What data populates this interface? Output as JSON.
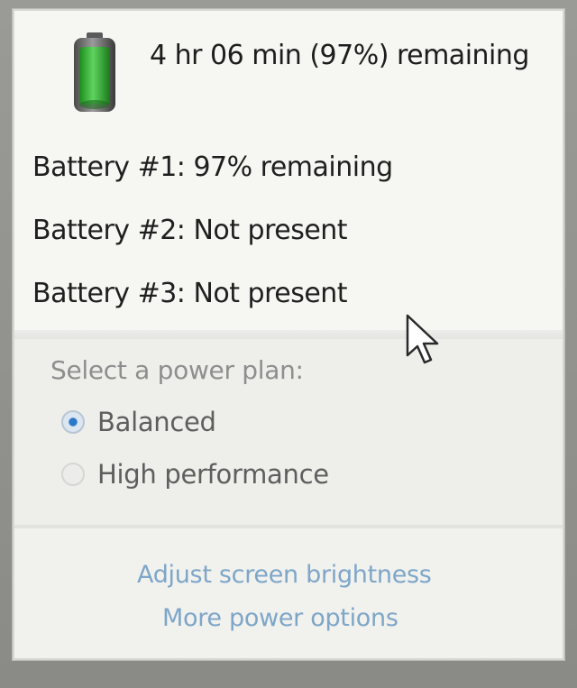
{
  "battery": {
    "summary": "4 hr 06 min (97%) remaining",
    "level_percent": 97,
    "icon": "battery-icon",
    "batteries": [
      {
        "label": "Battery #1: 97% remaining"
      },
      {
        "label": "Battery #2: Not present"
      },
      {
        "label": "Battery #3: Not present"
      }
    ]
  },
  "power_plan": {
    "title": "Select a power plan:",
    "options": [
      {
        "label": "Balanced",
        "selected": true
      },
      {
        "label": "High performance",
        "selected": false
      }
    ]
  },
  "links": {
    "brightness": "Adjust screen brightness",
    "more_options": "More power options"
  },
  "colors": {
    "link": "#7ea6c8",
    "battery_fill": "#2fb02f",
    "radio_selected": "#2a78c8"
  }
}
